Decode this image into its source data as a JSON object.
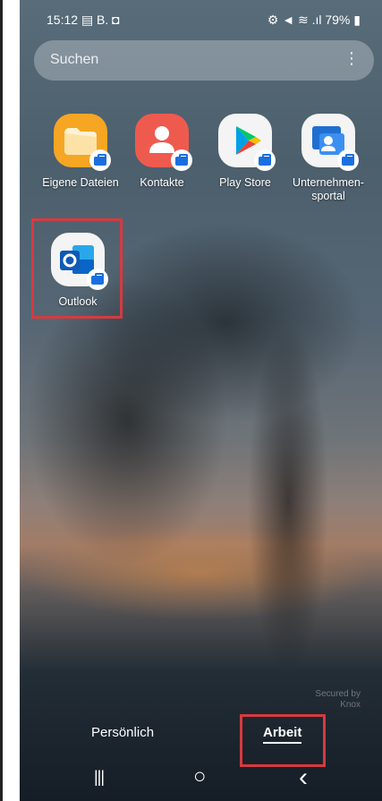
{
  "status_bar": {
    "time": "15:12",
    "left_icons": "▤ B. ◘",
    "right_icons": "⚙ ◄ ≋ .ıl",
    "battery": "79%"
  },
  "search": {
    "placeholder": "Suchen",
    "menu_glyph": "⋮"
  },
  "apps": [
    {
      "label": "Eigene Dateien",
      "icon": "folder-icon"
    },
    {
      "label": "Kontakte",
      "icon": "contact-icon"
    },
    {
      "label": "Play Store",
      "icon": "play-store-icon"
    },
    {
      "label": "Unternehmen-\nsportal",
      "label_line1": "Unternehmen-",
      "label_line2": "sportal",
      "icon": "company-portal-icon"
    },
    {
      "label": "Outlook",
      "icon": "outlook-icon"
    }
  ],
  "watermark": {
    "line1": "Secured by",
    "line2": "Knox"
  },
  "tabs": {
    "personal": "Persönlich",
    "work": "Arbeit"
  },
  "navbar": {
    "recent": "|||",
    "home": "○",
    "back": "‹"
  },
  "colors": {
    "highlight": "#d73a3f",
    "work_badge": "#1a6fe0",
    "folder": "#f5a623",
    "contacts": "#ef5a4f",
    "outlook": "#0a64c8"
  }
}
